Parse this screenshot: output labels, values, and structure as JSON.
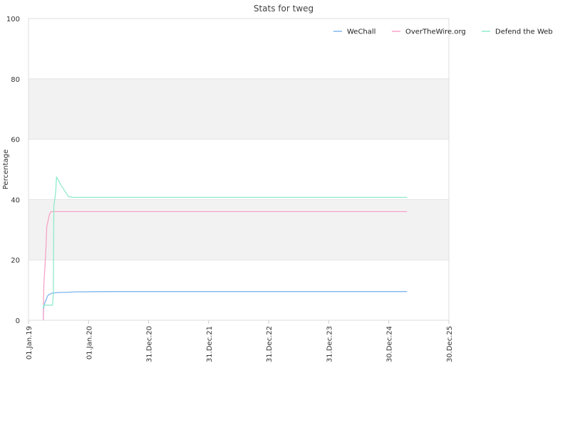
{
  "chart_data": {
    "type": "line",
    "title": "Stats for tweg",
    "xlabel": "",
    "ylabel": "Percentage",
    "ylim": [
      0,
      100
    ],
    "y_ticks": [
      0,
      20,
      40,
      60,
      80,
      100
    ],
    "xlim": [
      "2019-01-01",
      "2025-12-30"
    ],
    "x_ticks": [
      {
        "date": "2019-01-01",
        "label": "01.Jan.19"
      },
      {
        "date": "2020-01-01",
        "label": "01.Jan.20"
      },
      {
        "date": "2020-12-31",
        "label": "31.Dec.20"
      },
      {
        "date": "2021-12-31",
        "label": "31.Dec.21"
      },
      {
        "date": "2022-12-31",
        "label": "31.Dec.22"
      },
      {
        "date": "2023-12-31",
        "label": "31.Dec.23"
      },
      {
        "date": "2024-12-30",
        "label": "30.Dec.24"
      },
      {
        "date": "2025-12-30",
        "label": "30.Dec.25"
      }
    ],
    "grid": "horizontal bands",
    "legend_position": "top-right",
    "series": [
      {
        "name": "WeChall",
        "color": "#7cb5ec",
        "points": [
          [
            "2019-04-01",
            0
          ],
          [
            "2019-04-02",
            3
          ],
          [
            "2019-04-06",
            5
          ],
          [
            "2019-04-12",
            6
          ],
          [
            "2019-04-20",
            7
          ],
          [
            "2019-04-26",
            8
          ],
          [
            "2019-05-05",
            8.5
          ],
          [
            "2019-05-25",
            9
          ],
          [
            "2019-07-01",
            9.2
          ],
          [
            "2019-09-01",
            9.3
          ],
          [
            "2019-10-15",
            9.4
          ],
          [
            "2020-06-01",
            9.5
          ],
          [
            "2025-04-20",
            9.5
          ]
        ]
      },
      {
        "name": "OverTheWire.org",
        "color": "#f7a3c7",
        "points": [
          [
            "2019-04-01",
            0
          ],
          [
            "2019-04-04",
            12
          ],
          [
            "2019-04-08",
            15
          ],
          [
            "2019-04-14",
            21
          ],
          [
            "2019-04-18",
            25
          ],
          [
            "2019-04-22",
            31
          ],
          [
            "2019-04-30",
            33
          ],
          [
            "2019-05-08",
            35
          ],
          [
            "2019-05-18",
            36
          ],
          [
            "2025-04-20",
            36
          ]
        ]
      },
      {
        "name": "Defend the Web",
        "color": "#90ebc9",
        "points": [
          [
            "2019-04-01",
            4
          ],
          [
            "2019-04-03",
            5
          ],
          [
            "2019-05-27",
            5
          ],
          [
            "2019-06-01",
            9
          ],
          [
            "2019-06-04",
            38
          ],
          [
            "2019-06-12",
            41
          ],
          [
            "2019-06-16",
            43
          ],
          [
            "2019-06-20",
            47.5
          ],
          [
            "2019-07-15",
            45
          ],
          [
            "2019-09-01",
            41
          ],
          [
            "2019-10-01",
            40.7
          ],
          [
            "2025-04-20",
            40.7
          ]
        ]
      }
    ]
  }
}
